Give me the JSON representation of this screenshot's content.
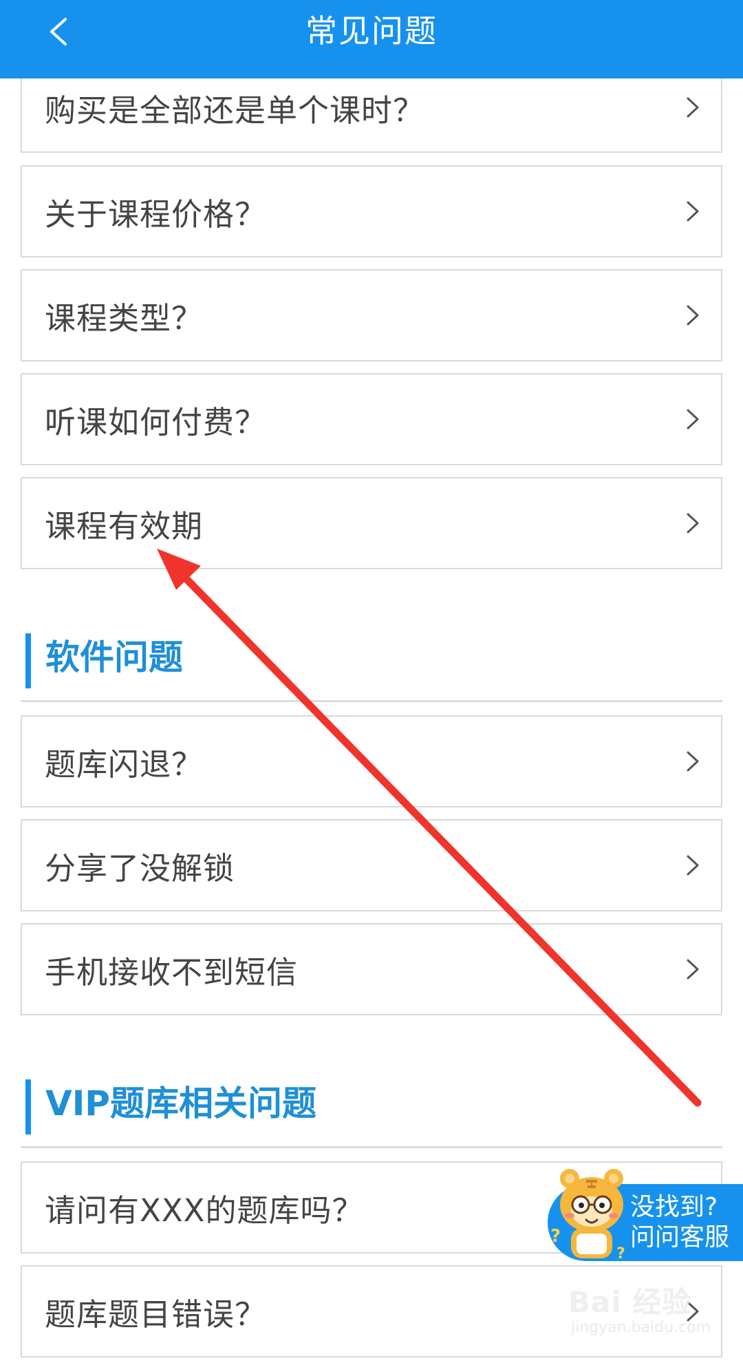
{
  "header": {
    "title": "常见问题",
    "back_icon": "chevron-left-icon"
  },
  "course_questions": [
    {
      "label": "购买是全部还是单个课时？"
    },
    {
      "label": "关于课程价格？"
    },
    {
      "label": "课程类型？"
    },
    {
      "label": "听课如何付费？"
    },
    {
      "label": "课程有效期"
    }
  ],
  "software_section": {
    "title": "软件问题",
    "items": [
      {
        "label": "题库闪退？"
      },
      {
        "label": "分享了没解锁"
      },
      {
        "label": "手机接收不到短信"
      }
    ]
  },
  "vip_section": {
    "title": "VIP题库相关问题",
    "items": [
      {
        "label": "请问有XXX的题库吗？"
      },
      {
        "label": "题库题目错误？"
      }
    ]
  },
  "customer_service": {
    "line1": "没找到?",
    "line2": "问问客服"
  },
  "watermark": {
    "main": "Bai 经验",
    "sub": "jingyan.baidu.com"
  },
  "colors": {
    "header_bg": "#1692ee",
    "section_title": "#1f8fd6",
    "annotation_arrow": "#f0342c"
  }
}
